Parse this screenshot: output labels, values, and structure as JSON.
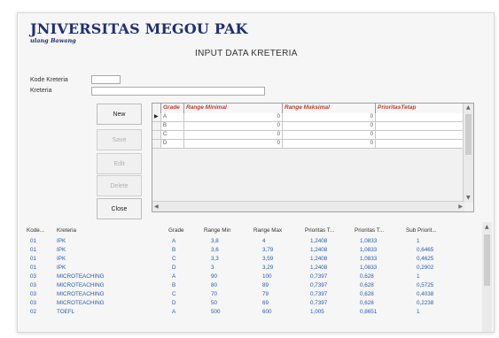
{
  "header": {
    "logo_title": "JNIVERSITAS MEGOU PAK",
    "logo_subtitle": "ulang Bawang",
    "form_title": "INPUT DATA KRETERIA"
  },
  "form": {
    "kode_label": "Kode Kreteria",
    "kode_value": "",
    "kreteria_label": "Kreteria",
    "kreteria_value": ""
  },
  "buttons": {
    "new": "New",
    "save": "Save",
    "edit": "Edit",
    "delete": "Delete",
    "close": "Close"
  },
  "grid": {
    "columns": [
      "Grade",
      "Range Minimal",
      "Range Maksimal",
      "PrioritasTetap"
    ],
    "rows": [
      {
        "grade": "A",
        "min": "0",
        "max": "0"
      },
      {
        "grade": "B",
        "min": "0",
        "max": "0"
      },
      {
        "grade": "C",
        "min": "0",
        "max": "0"
      },
      {
        "grade": "D",
        "min": "0",
        "max": "0"
      }
    ]
  },
  "table": {
    "columns": [
      "Kode...",
      "Kreteria",
      "Grade",
      "Range Min",
      "Range Max",
      "Prioritas T...",
      "Prioritas T...",
      "Sub Priorit..."
    ],
    "rows": [
      [
        "01",
        "IPK",
        "A",
        "3,8",
        "4",
        "1,2408",
        "1,0833",
        "1"
      ],
      [
        "01",
        "IPK",
        "B",
        "3,6",
        "3,79",
        "1,2408",
        "1,0833",
        "0,6465"
      ],
      [
        "01",
        "IPK",
        "C",
        "3,3",
        "3,59",
        "1,2408",
        "1,0833",
        "0,4625"
      ],
      [
        "01",
        "IPK",
        "D",
        "3",
        "3,29",
        "1,2408",
        "1,0833",
        "0,2902"
      ],
      [
        "03",
        "MICROTEACHING",
        "A",
        "90",
        "100",
        "0,7397",
        "0,628",
        "1"
      ],
      [
        "03",
        "MICROTEACHING",
        "B",
        "80",
        "89",
        "0,7397",
        "0,628",
        "0,5725"
      ],
      [
        "03",
        "MICROTEACHING",
        "C",
        "70",
        "79",
        "0,7397",
        "0,628",
        "0,4038"
      ],
      [
        "03",
        "MICROTEACHING",
        "D",
        "50",
        "69",
        "0,7397",
        "0,628",
        "0,2238"
      ],
      [
        "02",
        "TOEFL",
        "A",
        "500",
        "600",
        "1,005",
        "0,8651",
        "1"
      ]
    ]
  }
}
